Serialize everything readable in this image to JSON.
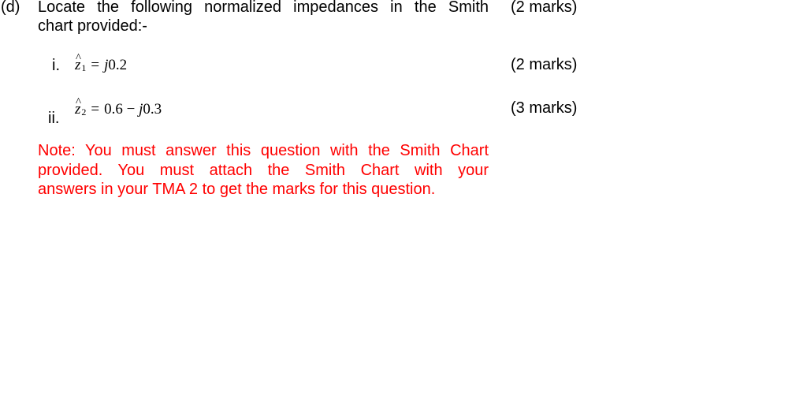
{
  "question": {
    "label": "(d)",
    "text_line1": "Locate the following normalized impedances in the Smith",
    "text_line2": "chart provided:-",
    "marks": "(2 marks)"
  },
  "items": [
    {
      "label": "i.",
      "variable": "z",
      "hat": "^",
      "subscript": "1",
      "equals": "=",
      "value": "j0.2",
      "marks": "(2 marks)"
    },
    {
      "label": "ii.",
      "variable": "z",
      "hat": "^",
      "subscript": "2",
      "equals": "=",
      "value": "0.6 − j0.3",
      "marks": "(3 marks)"
    }
  ],
  "note": {
    "line1": "Note: You must answer this question with the Smith Chart",
    "line2": "provided. You must attach the Smith Chart with your",
    "line3": "answers in your TMA 2 to get the marks for this question.",
    "color": "#ff0000"
  }
}
